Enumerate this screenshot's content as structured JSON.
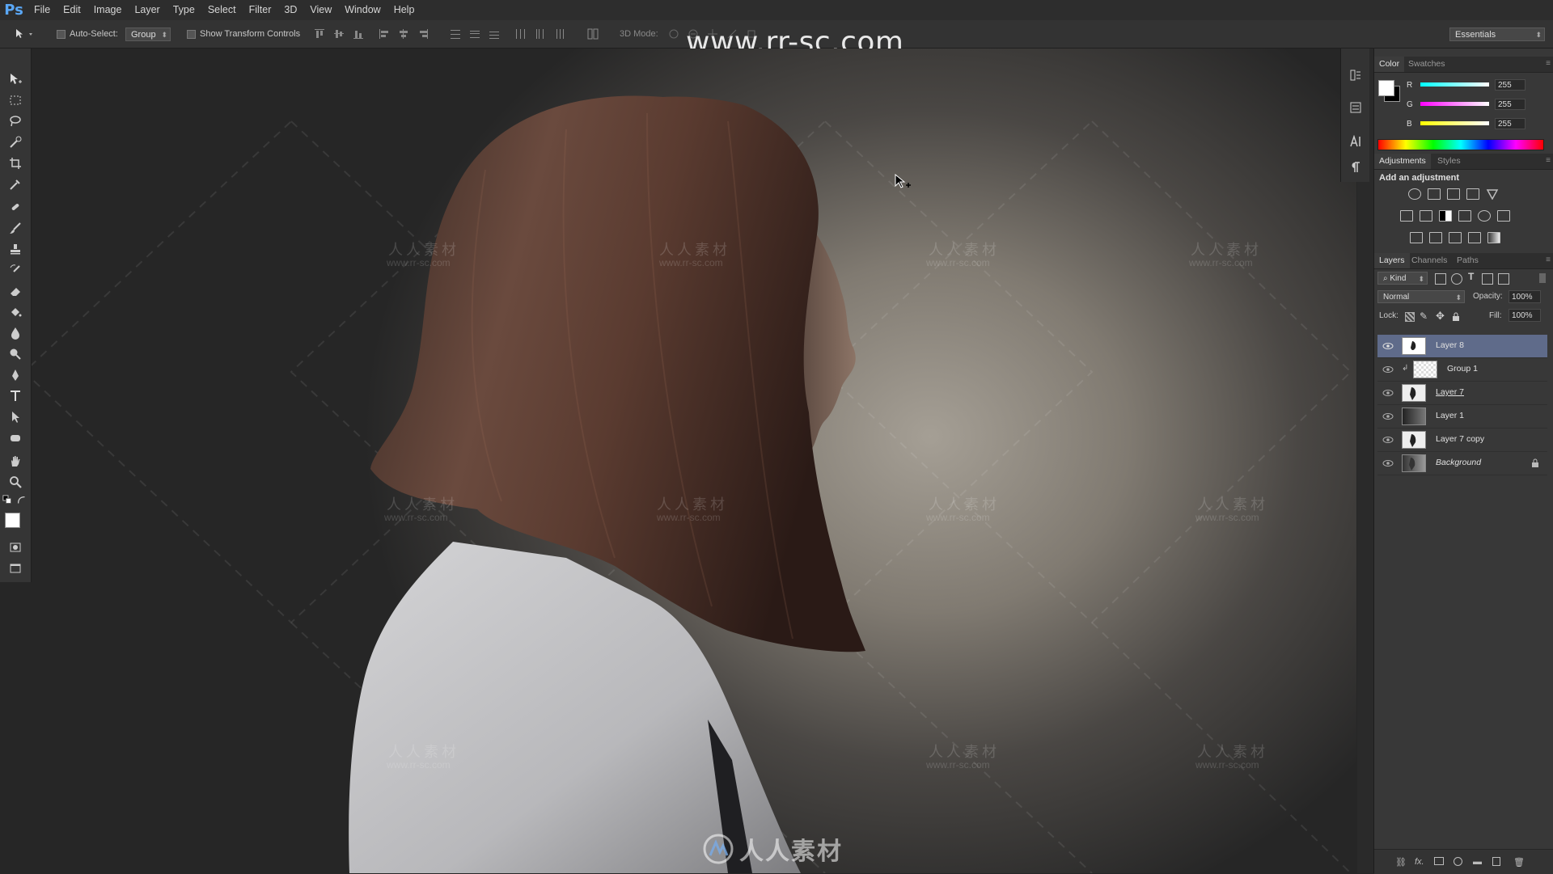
{
  "app": {
    "logo": "Ps",
    "watermark_url": "www.rr-sc.com"
  },
  "menubar": {
    "items": [
      "File",
      "Edit",
      "Image",
      "Layer",
      "Type",
      "Select",
      "Filter",
      "3D",
      "View",
      "Window",
      "Help"
    ]
  },
  "options": {
    "auto_select_label": "Auto-Select:",
    "auto_select_value": "Group",
    "show_transform_label": "Show Transform Controls",
    "mode_3d_label": "3D Mode:",
    "workspace": "Essentials"
  },
  "canvas": {
    "watermark_cn": "人人素材",
    "watermark_url": "www.rr-sc.com",
    "bottom_logo_text": "人人素材"
  },
  "color_panel": {
    "tabs": [
      "Color",
      "Swatches"
    ],
    "channels": [
      {
        "label": "R",
        "value": "255"
      },
      {
        "label": "G",
        "value": "255"
      },
      {
        "label": "B",
        "value": "255"
      }
    ]
  },
  "adjustments_panel": {
    "tabs": [
      "Adjustments",
      "Styles"
    ],
    "heading": "Add an adjustment"
  },
  "layers_panel": {
    "tabs": [
      "Layers",
      "Channels",
      "Paths"
    ],
    "filter_kind": "Kind",
    "blend_mode": "Normal",
    "opacity_label": "Opacity:",
    "opacity_value": "100%",
    "lock_label": "Lock:",
    "fill_label": "Fill:",
    "fill_value": "100%",
    "layers": [
      {
        "name": "Layer 8",
        "selected": true
      },
      {
        "name": "Group 1",
        "selected": false
      },
      {
        "name": "Layer 7",
        "selected": false
      },
      {
        "name": "Layer 1",
        "selected": false
      },
      {
        "name": "Layer 7 copy",
        "selected": false
      },
      {
        "name": "Background",
        "selected": false,
        "locked": true
      }
    ],
    "bottom_icons": [
      "link-icon",
      "fx",
      "mask-icon",
      "adjustment-icon",
      "folder-icon",
      "new-layer-icon",
      "trash-icon"
    ],
    "fx_label": "fx."
  },
  "colors": {
    "selection": "#5f6b8a",
    "accent_blue": "#5aa7f5"
  }
}
